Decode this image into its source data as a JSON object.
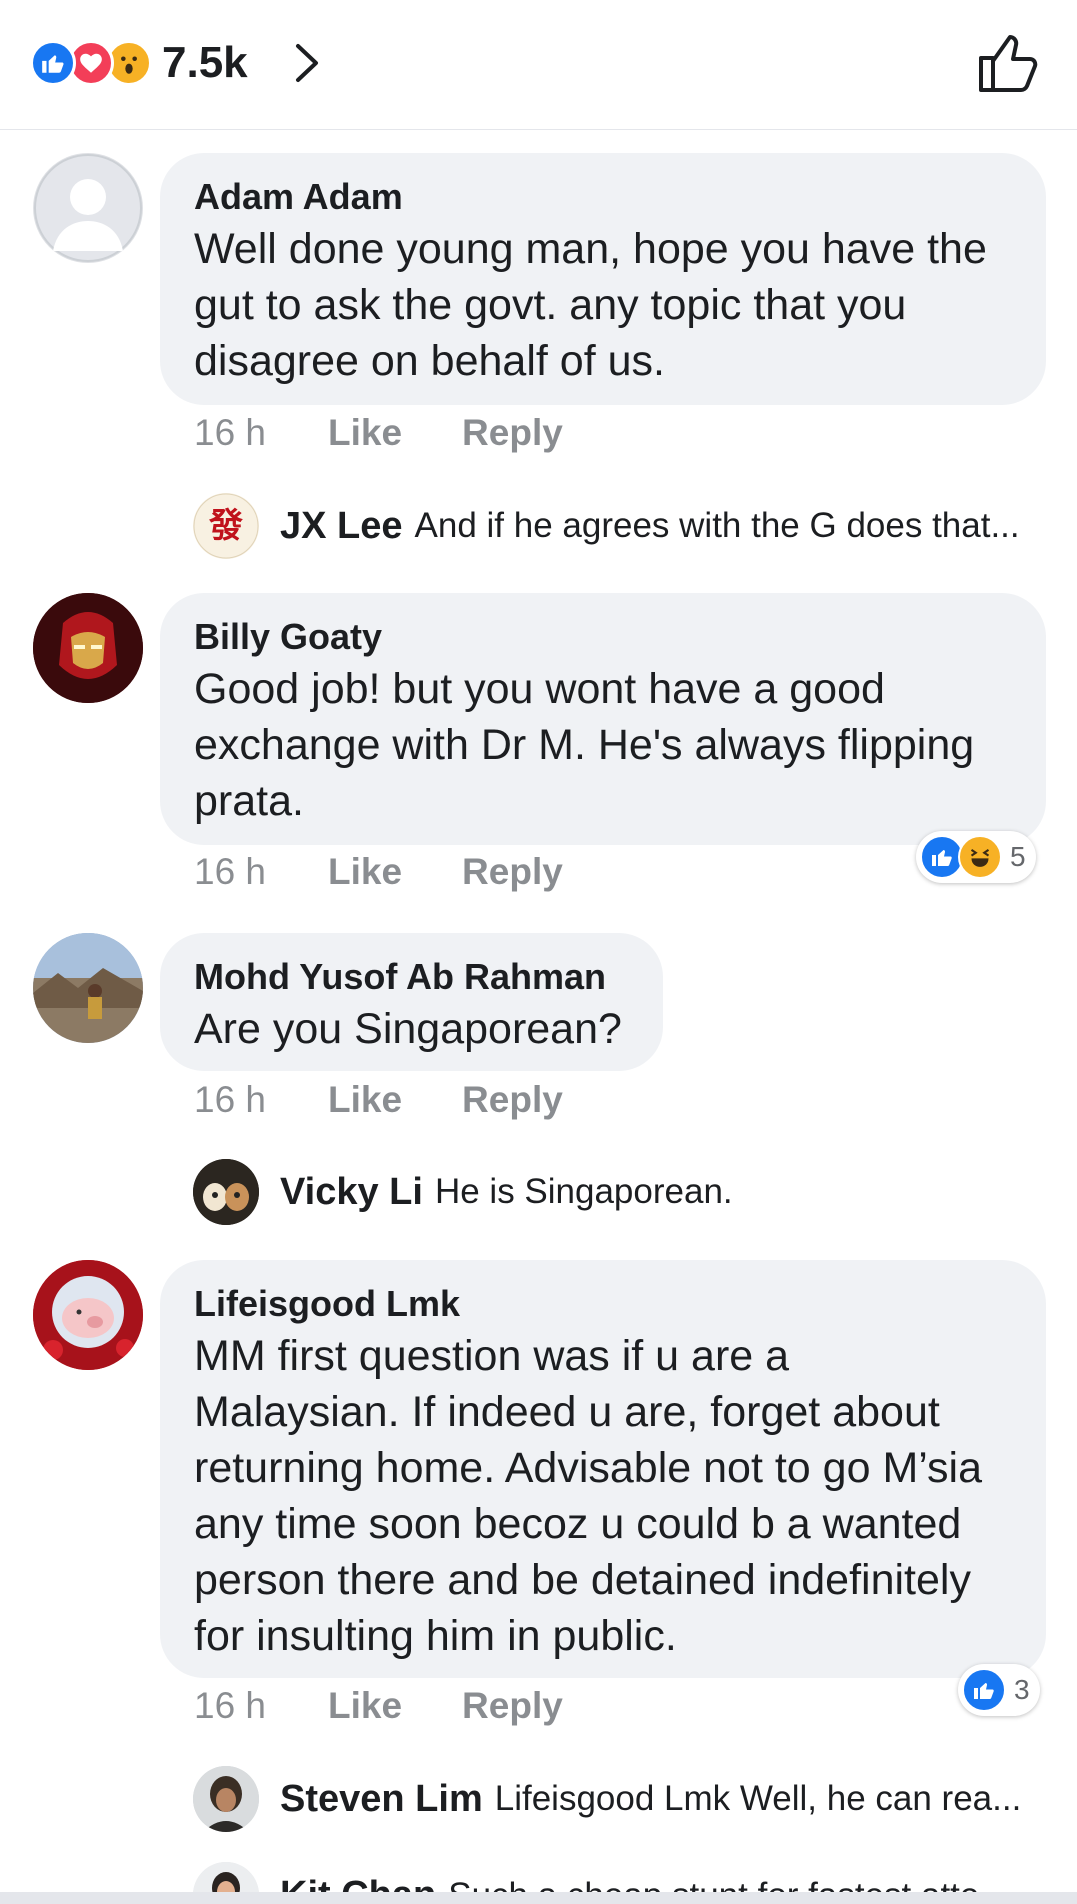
{
  "header": {
    "reaction_count": "7.5k",
    "reactions": [
      "like-icon",
      "love-icon",
      "wow-icon"
    ]
  },
  "comments": [
    {
      "author": "Adam Adam",
      "text": [
        "Well done young man, hope you have the",
        "gut to ask the govt. any topic that you",
        "disagree on behalf of us."
      ],
      "time": "16 h",
      "like": "Like",
      "reply": "Reply",
      "replies": [
        {
          "author": "JX Lee",
          "text": "And if he agrees with the G does that..."
        }
      ]
    },
    {
      "author": "Billy Goaty",
      "text": [
        "Good job! but you wont have a good",
        "exchange with Dr M. He's always flipping",
        "prata."
      ],
      "time": "16 h",
      "like": "Like",
      "reply": "Reply",
      "reaction_count": "5"
    },
    {
      "author": "Mohd Yusof Ab Rahman",
      "text": [
        "Are you Singaporean?"
      ],
      "time": "16 h",
      "like": "Like",
      "reply": "Reply",
      "replies": [
        {
          "author": "Vicky Li",
          "text": "He is Singaporean."
        }
      ]
    },
    {
      "author": "Lifeisgood Lmk",
      "text": [
        "MM first question was if u are a",
        "Malaysian. If indeed u are, forget about",
        "returning home. Advisable not to go M’sia",
        "any time soon becoz u could b a wanted",
        "person there and be detained indefinitely",
        "for insulting him in public."
      ],
      "time": "16 h",
      "like": "Like",
      "reply": "Reply",
      "reaction_count": "3",
      "replies": [
        {
          "author": "Steven Lim",
          "text": "Lifeisgood Lmk  Well, he can rea..."
        },
        {
          "author": "Kit Chan",
          "text": "Such a cheap stunt for fastest atte..."
        }
      ]
    }
  ],
  "colors": {
    "like_blue": "#1877f2",
    "love_red": "#f33e58",
    "haha_yellow": "#f7b125",
    "bubble_bg": "#f0f2f5",
    "meta_gray": "#8a8d91"
  }
}
